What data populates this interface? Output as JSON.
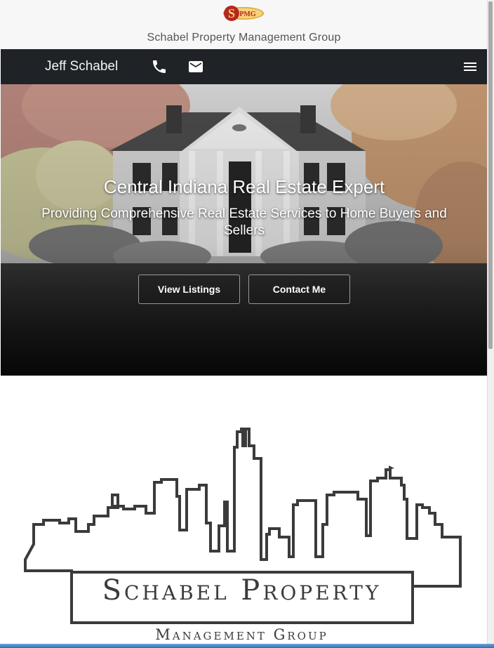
{
  "brand": {
    "logo_text": "SPMG",
    "name": "Schabel Property Management Group"
  },
  "navbar": {
    "agent_name": "Jeff Schabel",
    "icons": [
      "phone-icon",
      "mail-icon",
      "menu-icon"
    ]
  },
  "hero": {
    "title": "Central Indiana Real Estate Expert",
    "subtitle": "Providing Comprehensive Real Estate Services to Home Buyers and Sellers",
    "buttons": {
      "listings": "View Listings",
      "contact": "Contact Me"
    }
  },
  "skyline_logo": {
    "title": "Schabel Property",
    "subtitle": "Management Group"
  },
  "colors": {
    "navbar": "#1f2328",
    "brand_bg": "#f7f7f7",
    "logo_red": "#b5281e",
    "logo_gold": "#e2a73a",
    "skyline_line": "#3b3b3b"
  }
}
